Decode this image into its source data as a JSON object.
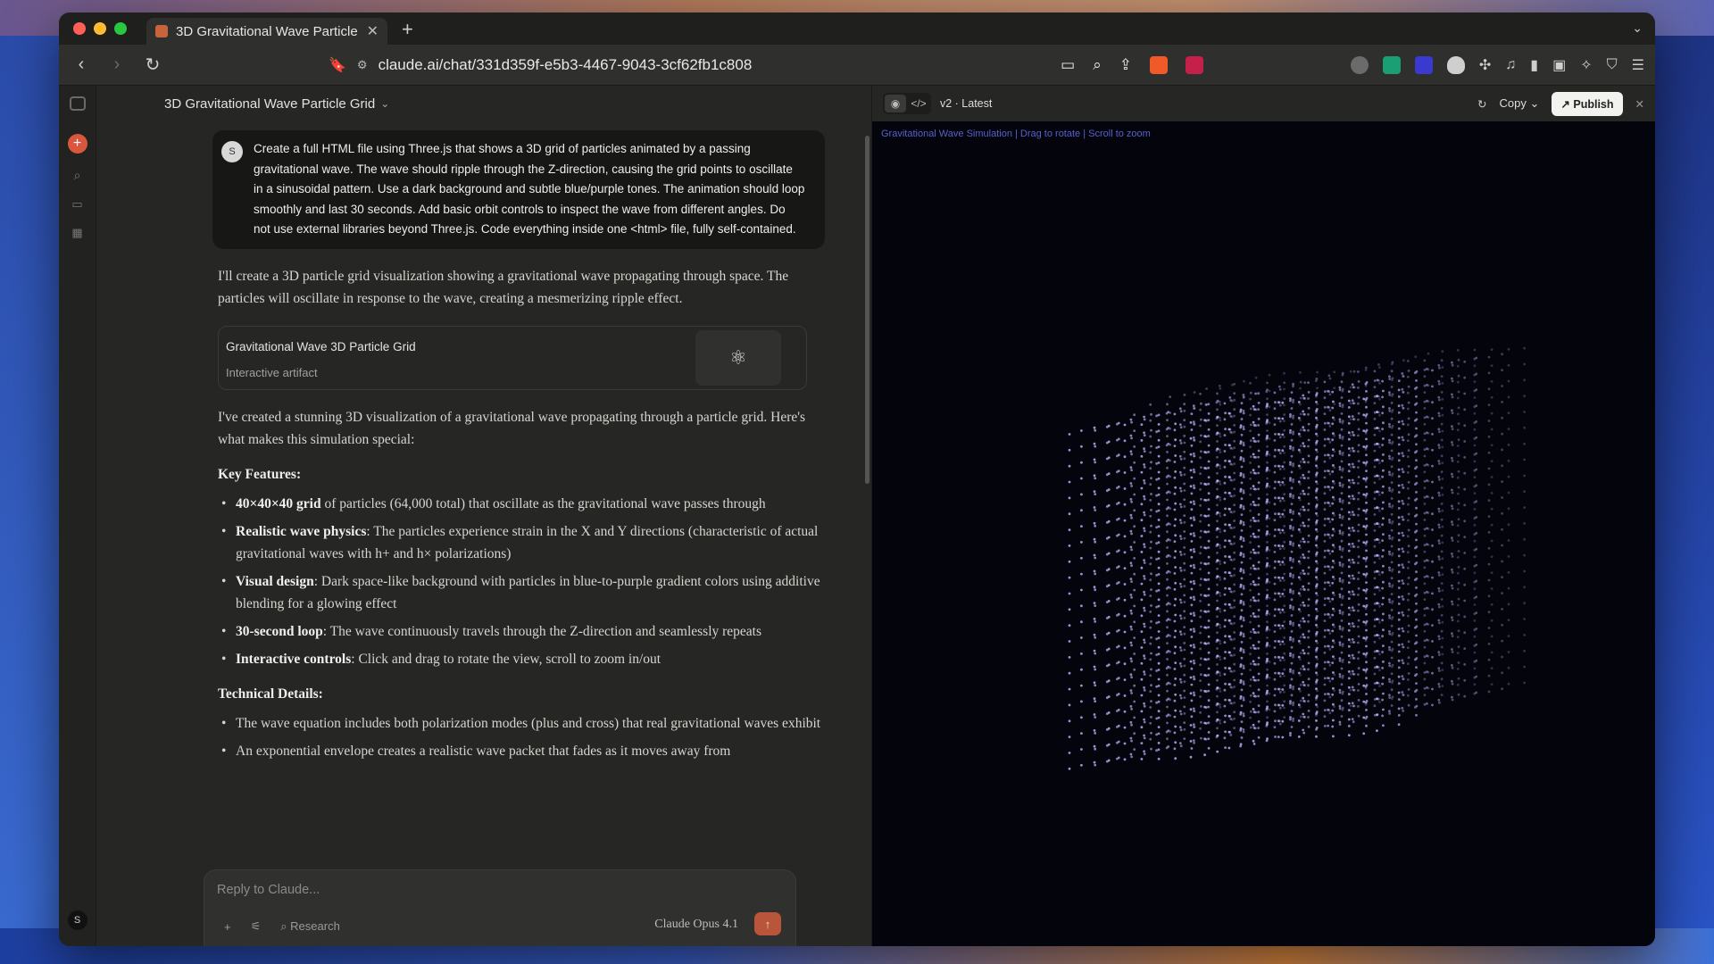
{
  "browser": {
    "tab_title": "3D Gravitational Wave Particle",
    "url": "claude.ai/chat/331d359f-e5b3-4467-9043-3cf62fb1c808"
  },
  "chat": {
    "title": "3D Gravitational Wave Particle Grid",
    "user_avatar": "S",
    "user_message": "Create a full HTML file using Three.js that shows a 3D grid of particles animated by a passing gravitational wave. The wave should ripple through the Z-direction, causing the grid points to oscillate in a sinusoidal pattern. Use a dark background and subtle blue/purple tones. The animation should loop smoothly and last 30 seconds. Add basic orbit controls to inspect the wave from different angles. Do not use external libraries beyond Three.js. Code everything inside one <html> file, fully self-contained.",
    "intro": "I'll create a 3D particle grid visualization showing a gravitational wave propagating through space. The particles will oscillate in response to the wave, creating a mesmerizing ripple effect.",
    "artifact": {
      "title": "Gravitational Wave 3D Particle Grid",
      "subtitle": "Interactive artifact"
    },
    "summary": "I've created a stunning 3D visualization of a gravitational wave propagating through a particle grid. Here's what makes this simulation special:",
    "key_features_heading": "Key Features:",
    "features": [
      {
        "bold": "40×40×40 grid",
        "text": " of particles (64,000 total) that oscillate as the gravitational wave passes through"
      },
      {
        "bold": "Realistic wave physics",
        "text": ": The particles experience strain in the X and Y directions (characteristic of actual gravitational waves with h+ and h× polarizations)"
      },
      {
        "bold": "Visual design",
        "text": ": Dark space-like background with particles in blue-to-purple gradient colors using additive blending for a glowing effect"
      },
      {
        "bold": "30-second loop",
        "text": ": The wave continuously travels through the Z-direction and seamlessly repeats"
      },
      {
        "bold": "Interactive controls",
        "text": ": Click and drag to rotate the view, scroll to zoom in/out"
      }
    ],
    "technical_heading": "Technical Details:",
    "technical": [
      "The wave equation includes both polarization modes (plus and cross) that real gravitational waves exhibit",
      "An exponential envelope creates a realistic wave packet that fades as it moves away from"
    ],
    "composer_placeholder": "Reply to Claude...",
    "research_label": "Research",
    "model_label": "Claude Opus 4.1",
    "sidebar_avatar": "S"
  },
  "panel": {
    "version_label": "v2 · Latest",
    "copy_label": "Copy",
    "publish_label": "Publish",
    "canvas_caption": "Gravitational Wave Simulation | Drag to rotate | Scroll to zoom"
  },
  "colors": {
    "accent": "#d9573c",
    "send": "#b8553a",
    "particle": "#b8b8ff"
  },
  "icons": {
    "artifact_thumb": "atom-icon",
    "nav": [
      "back-icon",
      "forward-icon",
      "reload-icon",
      "bookmark-icon"
    ]
  }
}
